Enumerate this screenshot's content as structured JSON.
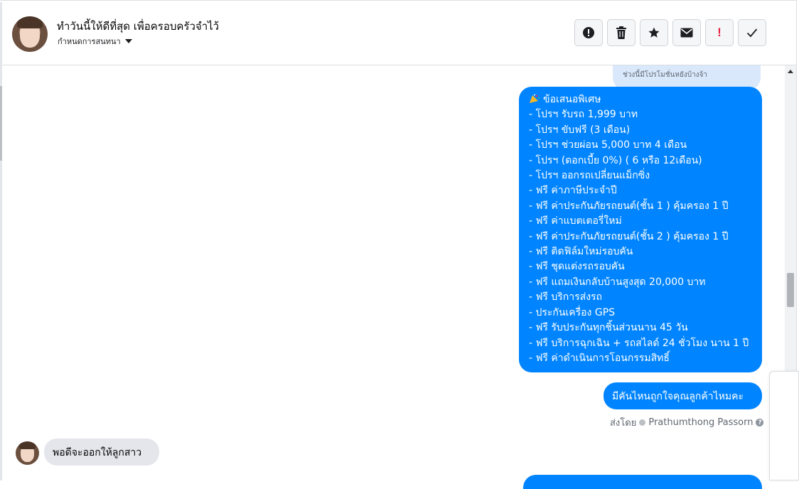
{
  "header": {
    "title": "ทำวันนี้ให้ดีที่สุด เพื่อครอบครัวจำไว้",
    "subtitle": "กำหนดการสนทนา"
  },
  "toolbar": {
    "buttons": [
      {
        "icon": "alert-circle-icon"
      },
      {
        "icon": "trash-icon"
      },
      {
        "icon": "star-icon"
      },
      {
        "icon": "envelope-icon"
      },
      {
        "icon": "exclamation-icon",
        "color": "#e41e3f"
      },
      {
        "icon": "checkmark-icon"
      }
    ],
    "exclamation_label": "!"
  },
  "messages": {
    "previous_snippet": "ช่วงนี้มีโปรโมชั่นหยังบ้างจ้า",
    "offer_lines": [
      "ข้อเสนอพิเศษ",
      "- โปรฯ รับรถ 1,999 บาท",
      "- โปรฯ ขับฟรี (3 เดือน)",
      "- โปรฯ ช่วยผ่อน 5,000 บาท 4 เดือน",
      "- โปรฯ (ดอกเบี้ย 0%) ( 6 หรือ 12เดือน)",
      "- โปรฯ ออกรถเปลี่ยนแม็กซิ่ง",
      "- ฟรี ค่าภาษีประจำปี",
      "- ฟรี ค่าประกันภัยรถยนต์(ชั้น 1 ) คุ้มครอง 1 ปี",
      "- ฟรี ค่าแบตเตอรี่ใหม่",
      "- ฟรี ค่าประกันภัยรถยนต์(ชั้น 2 ) คุ้มครอง 1 ปี",
      "- ฟรี ติดฟิล์มใหม่รอบคัน",
      "- ฟรี ชุดแต่งรถรอบคัน",
      "- ฟรี แถมเงินกลับบ้านสูงสุด 20,000 บาท",
      "- ฟรี บริการส่งรถ",
      "- ประกันเครื่อง GPS",
      "- ฟรี รับประกันทุกชิ้นส่วนนาน 45 วัน",
      "- ฟรี บริการฉุกเฉิน + รถสไลด์ 24 ชั่วโมง นาน 1 ปี",
      "- ฟรี ค่าดำเนินการโอนกรรมสิทธิ์"
    ],
    "question": "มีคันไหนถูกใจคุณลูกค้าไหมคะ",
    "sent_by_label": "ส่งโดย",
    "sent_by_name": "Prathumthong Passorn",
    "help_glyph": "?",
    "incoming": "พอดีจะออกให้ลูกสาว"
  },
  "colors": {
    "outgoing_bubble": "#0084ff",
    "incoming_bubble": "#e4e6eb",
    "previous_bubble": "#d9e8fb"
  }
}
